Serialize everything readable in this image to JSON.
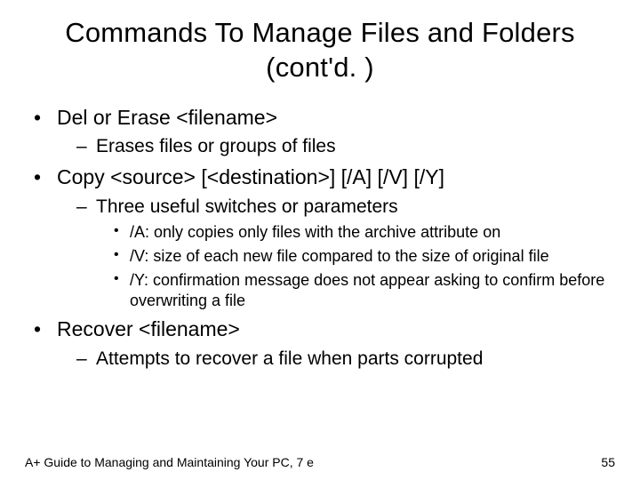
{
  "title": "Commands To Manage Files and Folders (cont'd. )",
  "items": [
    {
      "text": "Del or Erase <filename>",
      "sub": [
        {
          "text": "Erases files or groups of files"
        }
      ]
    },
    {
      "text": "Copy <source> [<destination>] [/A] [/V] [/Y]",
      "sub": [
        {
          "text": "Three useful switches or parameters",
          "sub": [
            {
              "text": "/A: only copies only files with the archive attribute on"
            },
            {
              "text": "/V: size of each new file compared to the size of original file"
            },
            {
              "text": "/Y: confirmation message does not appear asking to confirm before overwriting a file"
            }
          ]
        }
      ]
    },
    {
      "text": "Recover <filename>",
      "sub": [
        {
          "text": "Attempts to recover a file when parts corrupted"
        }
      ]
    }
  ],
  "footer_left": "A+ Guide to Managing and Maintaining Your PC, 7 e",
  "footer_right": "55"
}
